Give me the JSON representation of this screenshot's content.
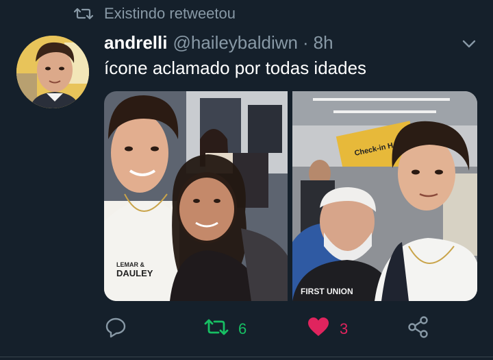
{
  "retweet_context": {
    "icon": "retweet-icon",
    "text": "Existindo retweetou"
  },
  "tweet": {
    "author_name": "andrelli",
    "author_handle": "@haileybaldiwn",
    "separator": "·",
    "time": "8h",
    "text": "ícone aclamado por todas idades",
    "menu_icon": "chevron-down-icon",
    "photos": [
      {
        "shirt_text_1": "LEMAR &",
        "shirt_text_2": "DAULEY"
      },
      {
        "shirt_text_1": "FIRST UNION",
        "sign_text": "Check-in H"
      }
    ]
  },
  "actions": {
    "reply": {
      "icon": "reply-icon"
    },
    "retweet": {
      "icon": "retweet-icon",
      "count": "6",
      "color": "#17bf63"
    },
    "like": {
      "icon": "heart-icon",
      "count": "3",
      "color": "#e0245e"
    },
    "share": {
      "icon": "share-icon"
    }
  },
  "colors": {
    "background": "#15202b",
    "secondary_text": "#8899a6",
    "primary_text": "#ffffff"
  }
}
